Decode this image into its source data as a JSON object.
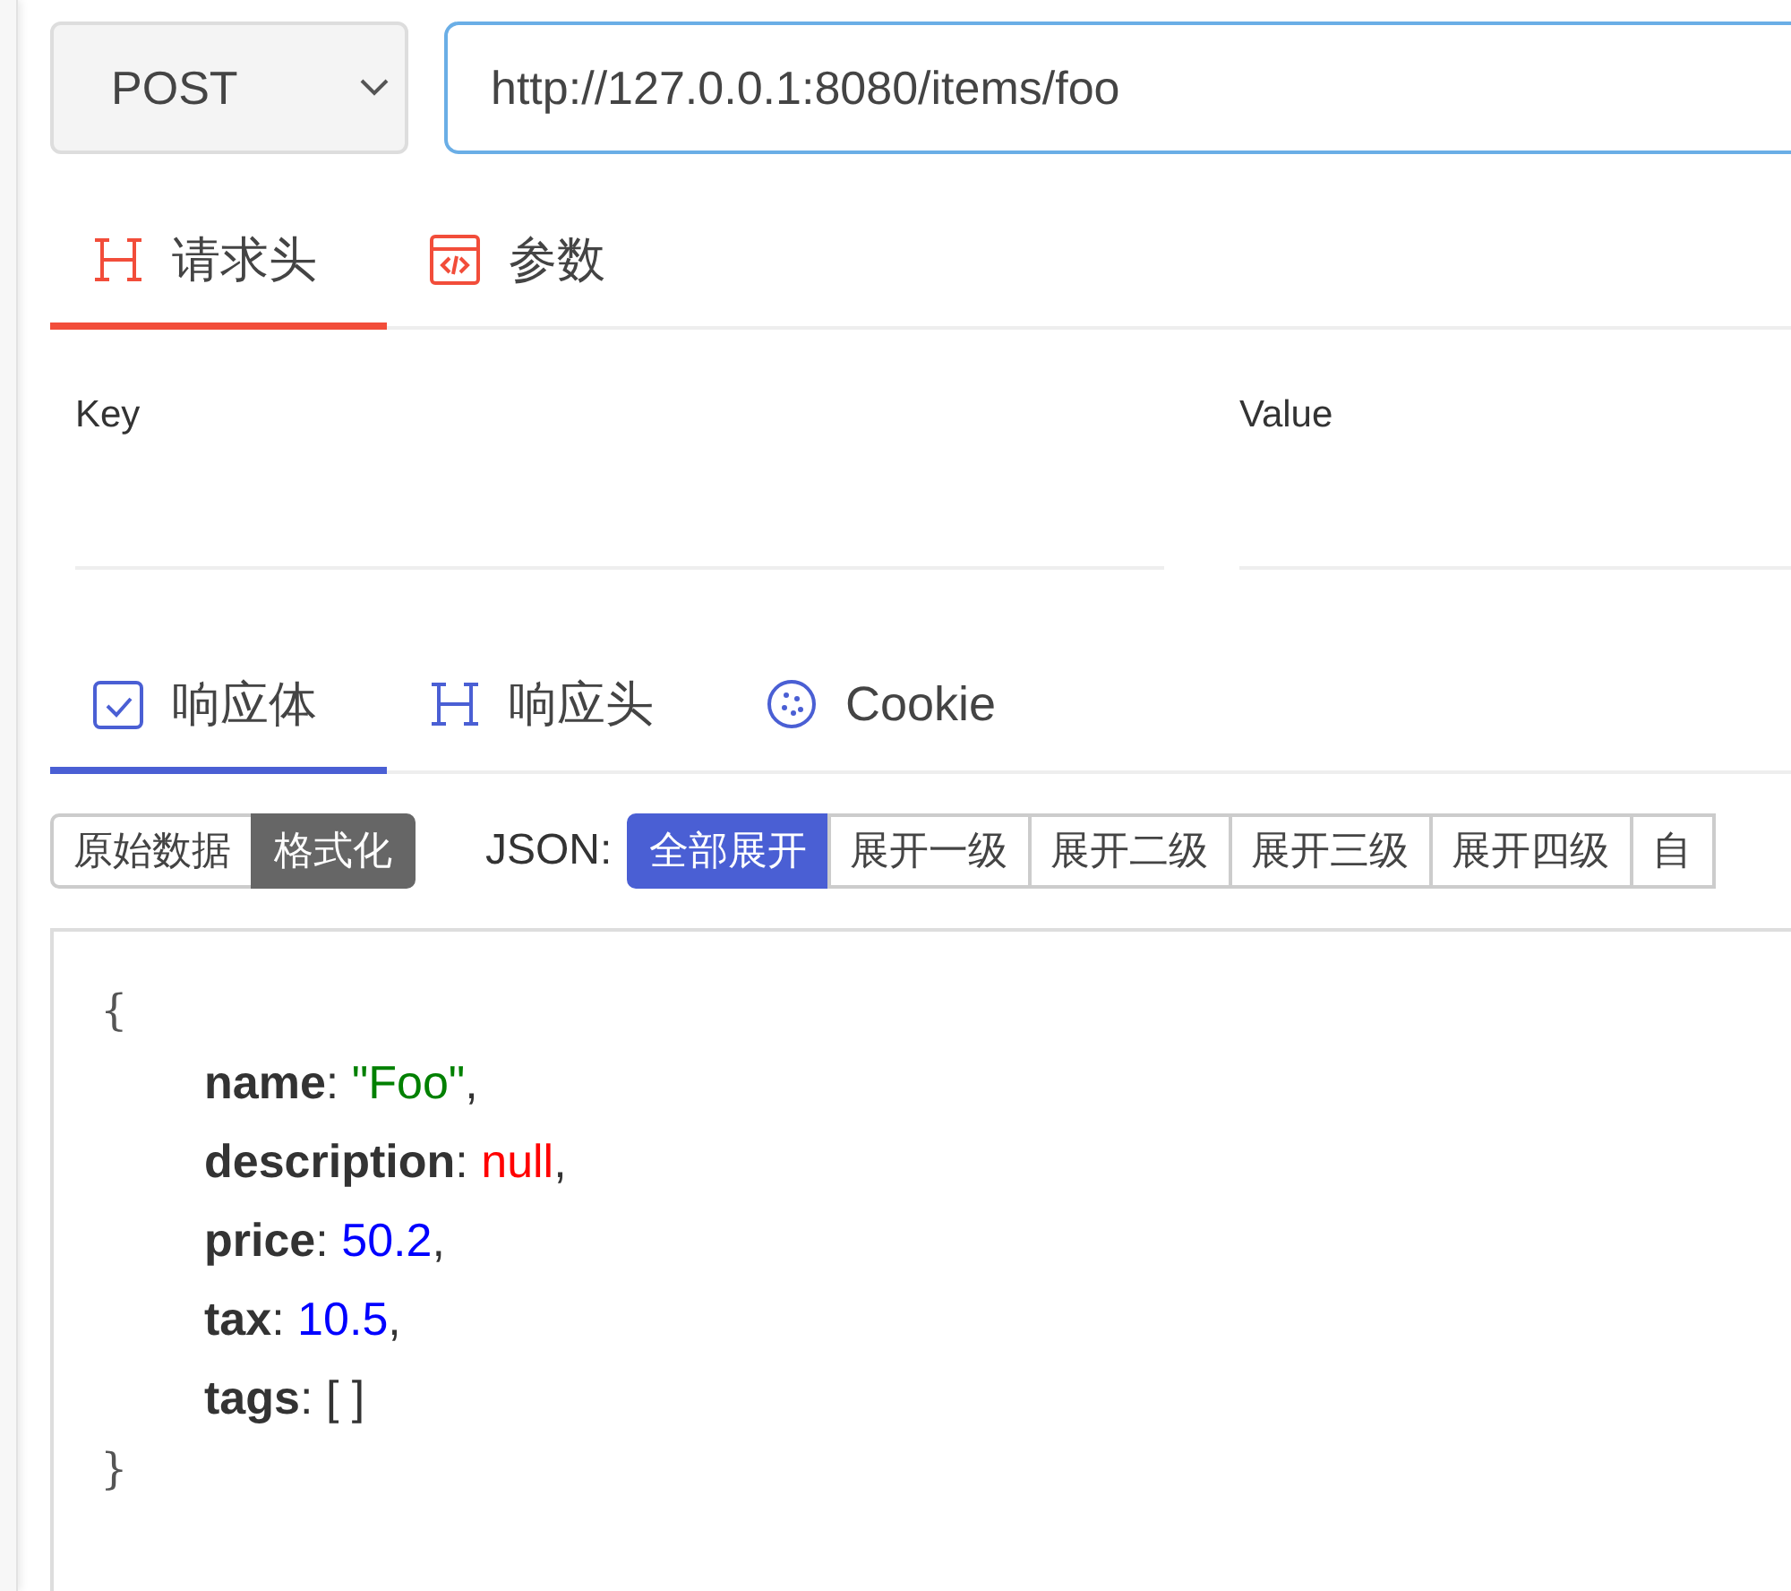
{
  "request": {
    "method": "POST",
    "url": "http://127.0.0.1:8080/items/foo"
  },
  "request_tabs": [
    {
      "label": "请求头",
      "selected": true
    },
    {
      "label": "参数",
      "selected": false
    }
  ],
  "headers_table": {
    "columns": [
      "Key",
      "Value"
    ]
  },
  "response_tabs": [
    {
      "label": "响应体",
      "selected": true
    },
    {
      "label": "响应头",
      "selected": false
    },
    {
      "label": "Cookie",
      "selected": false
    }
  ],
  "view_modes": [
    {
      "label": "原始数据",
      "selected": false
    },
    {
      "label": "格式化",
      "selected": true
    }
  ],
  "json_label": "JSON:",
  "expand_buttons": [
    {
      "label": "全部展开",
      "selected": true
    },
    {
      "label": "展开一级",
      "selected": false
    },
    {
      "label": "展开二级",
      "selected": false
    },
    {
      "label": "展开三级",
      "selected": false
    },
    {
      "label": "展开四级",
      "selected": false
    },
    {
      "label": "自",
      "selected": false
    }
  ],
  "response_body": {
    "open": "{",
    "close": "}",
    "fields": [
      {
        "key": "name",
        "colon": ":",
        "kind": "string",
        "value": "\"Foo\"",
        "comma": ","
      },
      {
        "key": "description",
        "colon": ":",
        "kind": "null",
        "value": "null",
        "comma": ","
      },
      {
        "key": "price",
        "colon": ":",
        "kind": "number",
        "value": "50.2",
        "comma": ","
      },
      {
        "key": "tax",
        "colon": ":",
        "kind": "number",
        "value": "10.5",
        "comma": ","
      },
      {
        "key": "tags",
        "colon": ":",
        "kind": "array",
        "value": "[ ]"
      }
    ]
  }
}
